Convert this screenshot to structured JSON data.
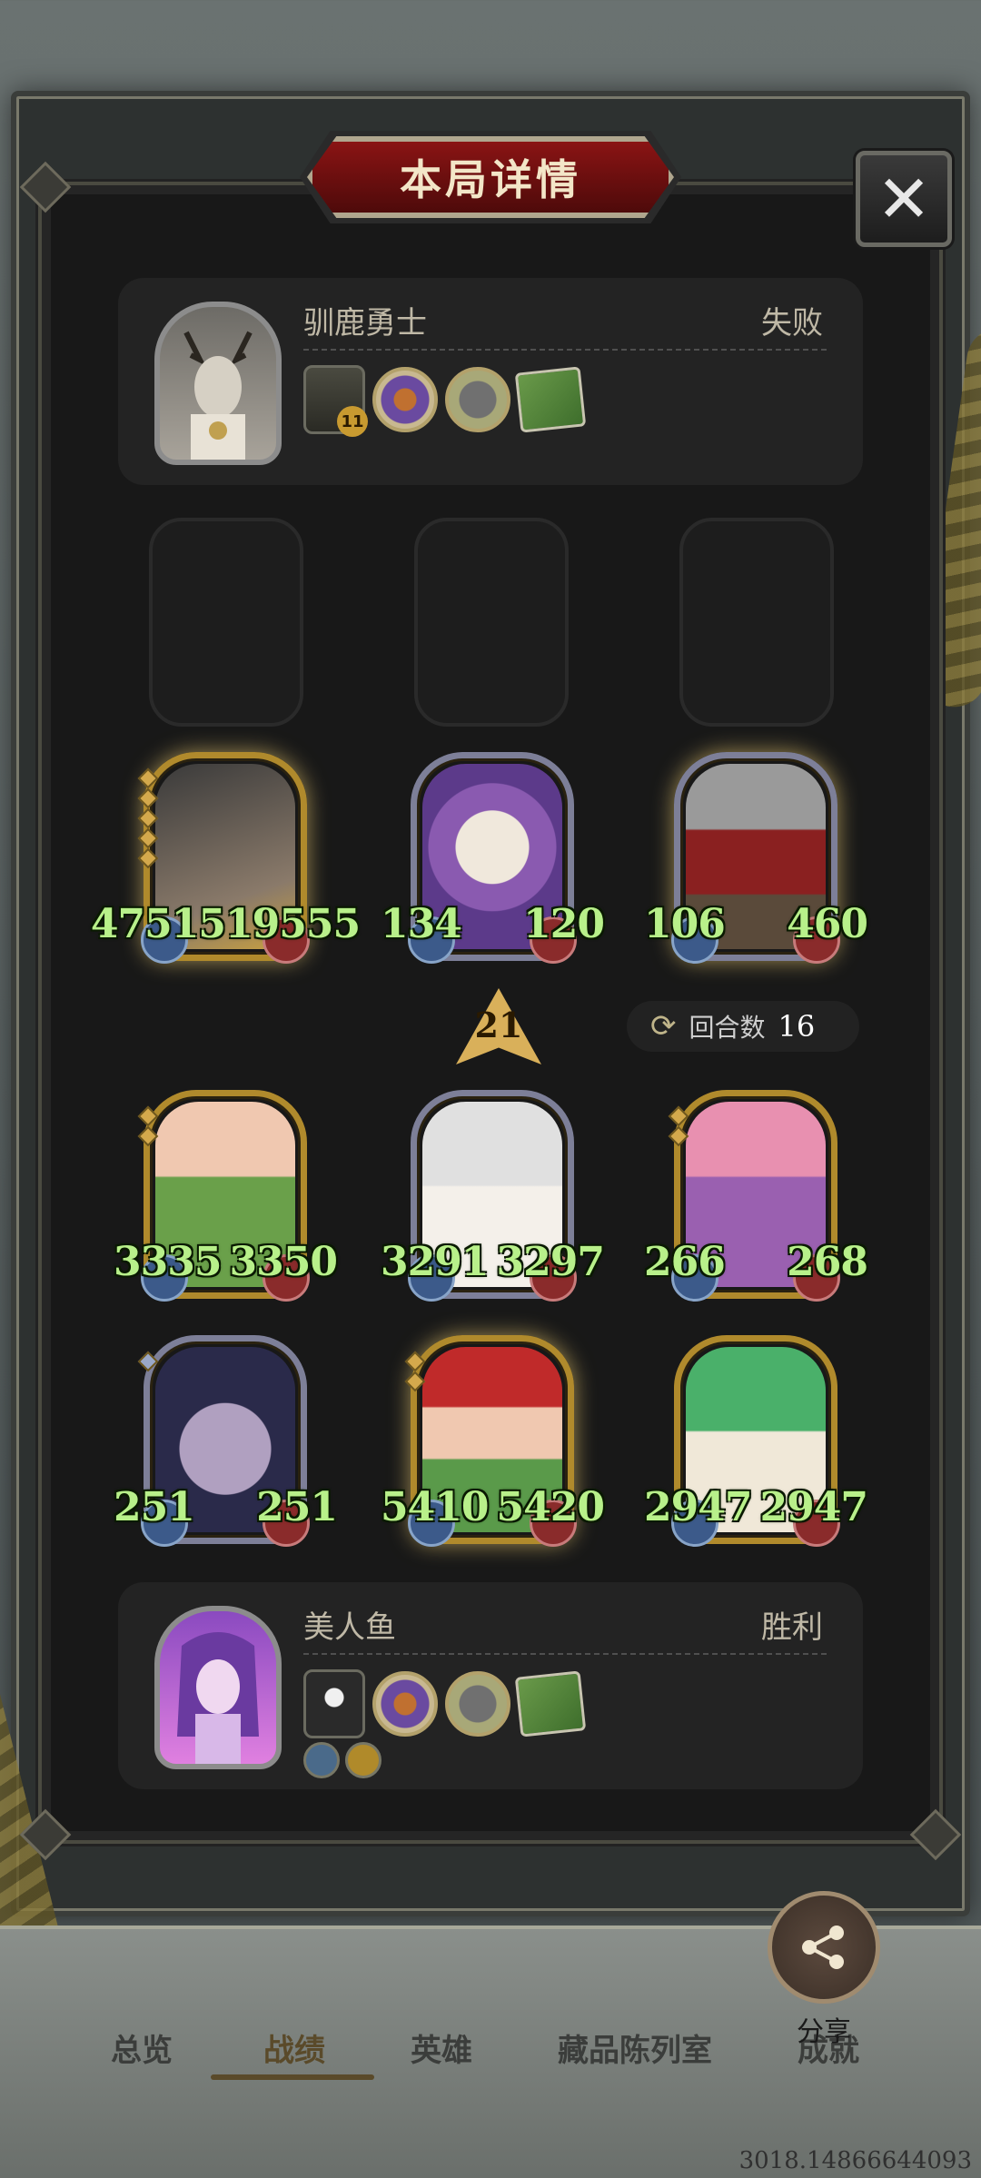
{
  "title": "本局详情",
  "close_symbol": "✕",
  "opponent": {
    "name": "驯鹿勇士",
    "result": "失败",
    "level_badge": "11"
  },
  "player": {
    "name": "美人鱼",
    "result": "胜利"
  },
  "enemy_heroes": [
    {
      "attack": "4751",
      "health": "519555",
      "frame": "gold"
    },
    {
      "attack": "134",
      "health": "120",
      "frame": "silver"
    },
    {
      "attack": "106",
      "health": "460",
      "frame": "silver"
    }
  ],
  "player_heroes_row1": [
    {
      "attack": "3335",
      "health": "3350",
      "frame": "gold"
    },
    {
      "attack": "3291",
      "health": "3297",
      "frame": "silver"
    },
    {
      "attack": "266",
      "health": "268",
      "frame": "gold"
    }
  ],
  "player_heroes_row2": [
    {
      "attack": "251",
      "health": "251",
      "frame": "silver"
    },
    {
      "attack": "5410",
      "health": "5420",
      "frame": "gold"
    },
    {
      "attack": "2947",
      "health": "2947",
      "frame": "gold"
    }
  ],
  "turn_indicator": "21",
  "round": {
    "label": "回合数",
    "value": "16"
  },
  "share_label": "分享",
  "nav": [
    "总览",
    "战绩",
    "英雄",
    "藏品陈列室",
    "成就"
  ],
  "active_nav": "战绩",
  "version": "3018.14866644093"
}
